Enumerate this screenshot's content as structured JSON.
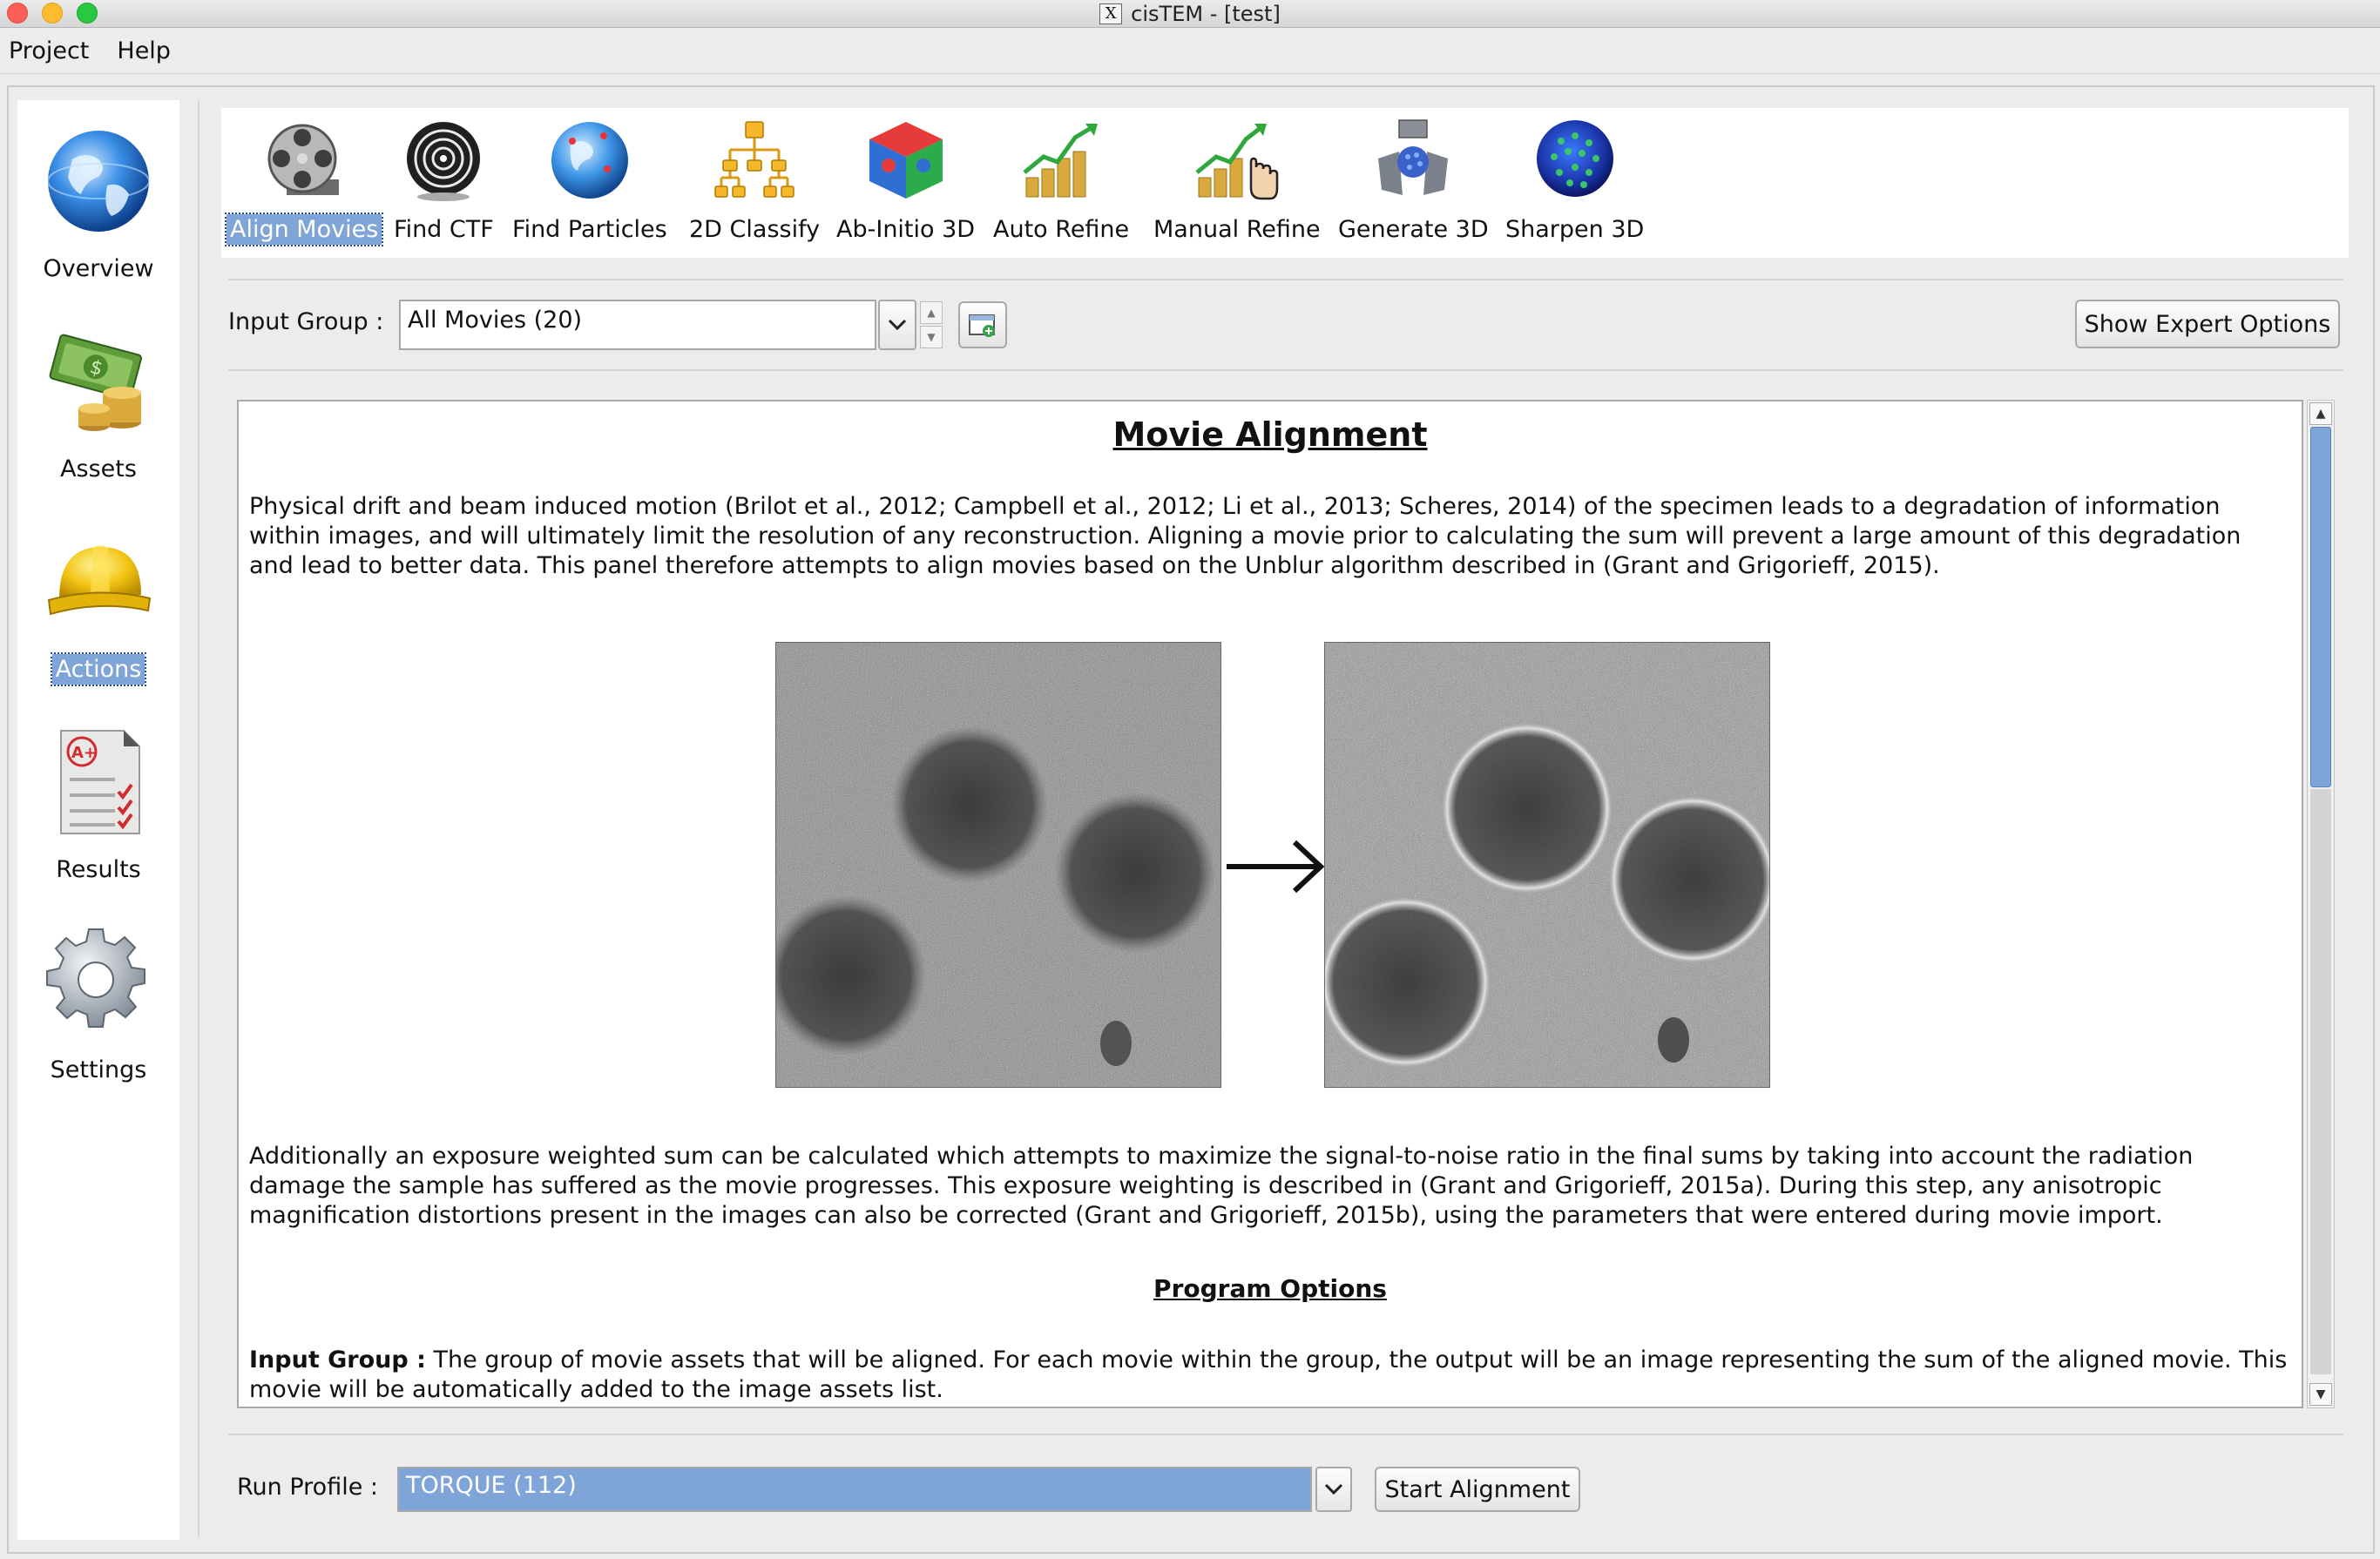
{
  "window": {
    "title": "cisTEM - [test]",
    "title_icon": "x11-icon",
    "title_icon_glyph": "X"
  },
  "menubar": {
    "items": [
      "Project",
      "Help"
    ]
  },
  "sidebar": {
    "items": [
      {
        "label": "Overview",
        "icon": "globe-icon"
      },
      {
        "label": "Assets",
        "icon": "money-icon"
      },
      {
        "label": "Actions",
        "icon": "hardhat-icon",
        "selected": true
      },
      {
        "label": "Results",
        "icon": "report-card-icon"
      },
      {
        "label": "Settings",
        "icon": "gear-icon"
      }
    ]
  },
  "toolbar": {
    "items": [
      {
        "label": "Align Movies",
        "icon": "film-reel-icon",
        "selected": true
      },
      {
        "label": "Find CTF",
        "icon": "ctf-rings-icon"
      },
      {
        "label": "Find Particles",
        "icon": "globe-pins-icon"
      },
      {
        "label": "2D Classify",
        "icon": "hierarchy-icon"
      },
      {
        "label": "Ab-Initio 3D",
        "icon": "puzzle-cube-icon"
      },
      {
        "label": "Auto Refine",
        "icon": "growth-chart-icon"
      },
      {
        "label": "Manual Refine",
        "icon": "growth-chart-hand-icon"
      },
      {
        "label": "Generate 3D",
        "icon": "reconstruct-icon"
      },
      {
        "label": "Sharpen 3D",
        "icon": "virus-sphere-icon"
      }
    ]
  },
  "input_group": {
    "label": "Input Group :",
    "value": "All Movies (20)"
  },
  "expert_button": "Show Expert Options",
  "info": {
    "title": "Movie Alignment",
    "paragraph1": "Physical drift and beam induced motion (Brilot et al., 2012; Campbell et al., 2012; Li et al., 2013; Scheres, 2014) of the specimen leads to a degradation of information within images, and will ultimately limit the resolution of any reconstruction.  Aligning a movie prior to calculating the sum will prevent a large amount of this degradation and lead to better data.  This panel therefore attempts to align movies based on the Unblur algorithm described in (Grant and Grigorieff, 2015).",
    "paragraph2": "Additionally an exposure weighted sum can be calculated which attempts to maximize the signal-to-noise ratio in the final sums by taking into account the radiation damage the sample has suffered as the movie progresses.  This exposure weighting is described in (Grant and Grigorieff, 2015a).  During this step, any anisotropic magnification distortions present in the images can also be corrected (Grant and Grigorieff, 2015b), using the parameters that were entered during movie import.",
    "section_title": "Program Options",
    "option_name": "Input Group :",
    "option_text": " The group of movie assets that will be aligned.  For each movie within the group, the output will be an image representing the sum of the aligned movie.  This movie will be automatically added to the image assets list."
  },
  "run_profile": {
    "label": "Run Profile :",
    "value": "TORQUE (112)"
  },
  "start_button": "Start Alignment",
  "colors": {
    "selection": "#7ea4d8",
    "close": "#fc5f57",
    "minimize": "#fdbc2e",
    "zoom": "#28c840"
  }
}
